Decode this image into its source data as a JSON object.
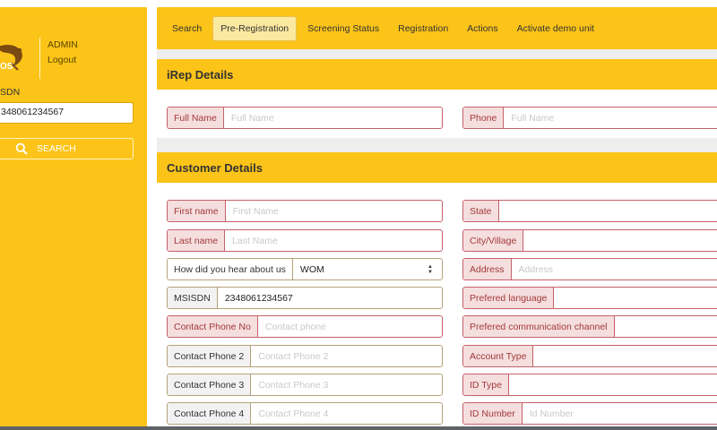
{
  "sidebar": {
    "logo_text": "OS",
    "user_role": "ADMIN",
    "logout_label": "Logout",
    "msisdn_label": "SDN",
    "msisdn_value": "348061234567",
    "search_label": "SEARCH"
  },
  "nav": {
    "items": [
      "Search",
      "Pre-Registration",
      "Screening Status",
      "Registration",
      "Actions",
      "Activate demo unit"
    ],
    "active": "Pre-Registration"
  },
  "irep": {
    "title": "iRep Details",
    "full_name_label": "Full Name",
    "full_name_placeholder": "Full Name",
    "phone_label": "Phone",
    "phone_placeholder": "Full Name"
  },
  "customer": {
    "title": "Customer Details",
    "left": [
      {
        "label": "First name",
        "placeholder": "First Name",
        "error": true
      },
      {
        "label": "Last name",
        "placeholder": "Last Name",
        "error": true
      },
      {
        "label": "How did you hear about us",
        "value": "WOM",
        "select": true,
        "error": false
      },
      {
        "label": "MSISDN",
        "value": "2348061234567",
        "error": false
      },
      {
        "label": "Contact Phone No",
        "placeholder": "Contact phone",
        "error": true
      },
      {
        "label": "Contact Phone 2",
        "placeholder": "Contact Phone 2",
        "error": false
      },
      {
        "label": "Contact Phone 3",
        "placeholder": "Contact Phone 3",
        "error": false
      },
      {
        "label": "Contact Phone 4",
        "placeholder": "Contact Phone 4",
        "error": false
      }
    ],
    "right": [
      {
        "label": "State",
        "placeholder": "",
        "error": true
      },
      {
        "label": "City/Village",
        "placeholder": "",
        "error": true
      },
      {
        "label": "Address",
        "placeholder": "Address",
        "error": true
      },
      {
        "label": "Prefered language",
        "placeholder": "",
        "error": true
      },
      {
        "label": "Prefered communication channel",
        "placeholder": "",
        "error": true
      },
      {
        "label": "Account Type",
        "placeholder": "",
        "error": true
      },
      {
        "label": "ID Type",
        "placeholder": "",
        "error": true
      },
      {
        "label": "ID Number",
        "placeholder": "Id Number",
        "error": true
      }
    ]
  },
  "colors": {
    "accent": "#fcc419",
    "error_border": "#c4616a",
    "error_bg": "#f5dede"
  }
}
